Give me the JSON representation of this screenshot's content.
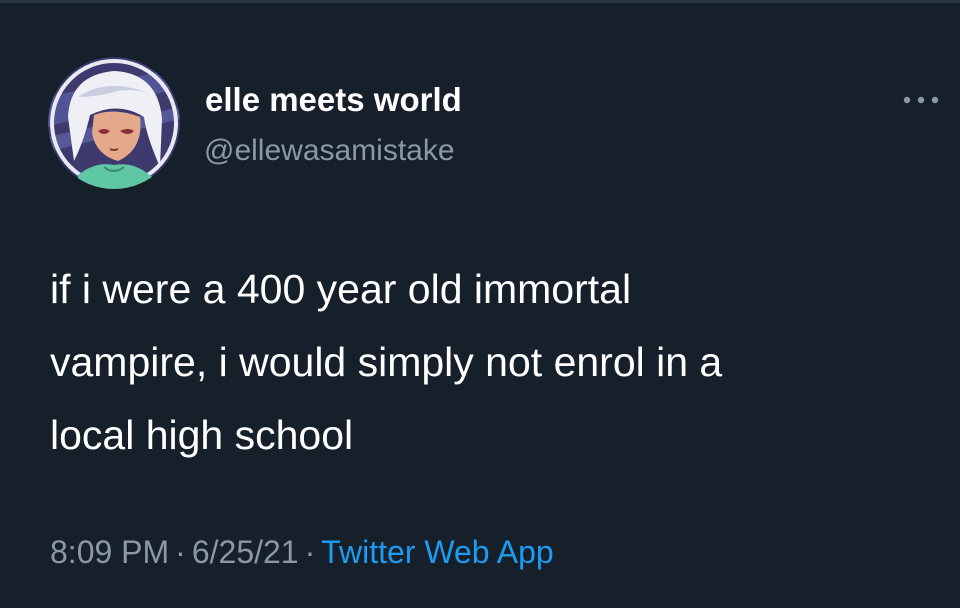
{
  "tweet": {
    "display_name": "elle meets world",
    "handle": "@ellewasamistake",
    "text": "if i were a 400 year old immortal\nvampire, i would simply not enrol in a\nlocal high school",
    "time": "8:09 PM",
    "date": "6/25/21",
    "source": "Twitter Web App",
    "separator": "·",
    "avatar_icon": "anime-character-avatar",
    "more_icon": "more-options-icon"
  },
  "colors": {
    "background": "#15202b",
    "primary_text": "#ffffff",
    "secondary_text": "#8b98a5",
    "accent": "#1d9bf0"
  }
}
